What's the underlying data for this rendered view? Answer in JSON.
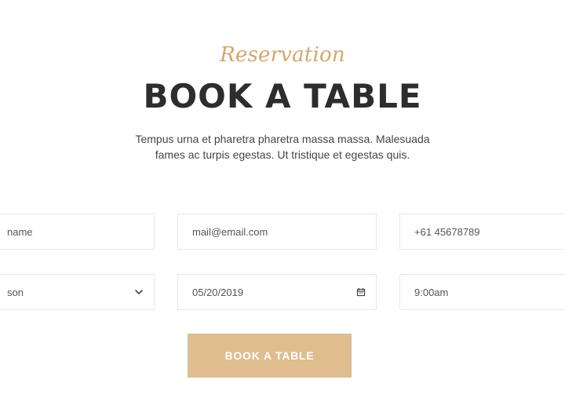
{
  "header": {
    "eyebrow": "Reservation",
    "title": "BOOK A TABLE",
    "subtitle_line1": "Tempus urna et pharetra pharetra massa massa. Malesuada",
    "subtitle_line2": "fames ac turpis egestas. Ut tristique et egestas quis."
  },
  "form": {
    "row1": {
      "name": "name",
      "email": "mail@email.com",
      "phone": "+61 45678789"
    },
    "row2": {
      "guests": "son",
      "date": "05/20/2019",
      "time": "9:00am"
    },
    "submit_label": "BOOK A TABLE"
  },
  "icons": {
    "select": "chevron-down-icon",
    "date": "calendar-icon"
  },
  "colors": {
    "accent": "#d2a76e",
    "button": "#dfbd8f"
  }
}
